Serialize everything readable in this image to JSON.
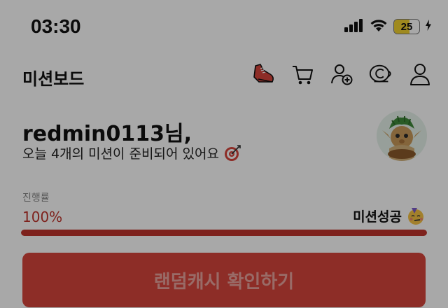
{
  "status_bar": {
    "time": "03:30",
    "battery_level": "25",
    "icons": [
      "cellular-signal-icon",
      "wifi-icon",
      "battery-charging-icon"
    ]
  },
  "header": {
    "title": "미션보드",
    "icons": [
      "sneaker-icon",
      "cart-icon",
      "add-friend-icon",
      "coin-icon",
      "profile-icon"
    ]
  },
  "greeting": {
    "name": "redmin0113님,",
    "subtitle": "오늘 4개의 미션이 준비되어 있어요",
    "subtitle_icon": "target-icon",
    "avatar_icon": "goblin-avatar"
  },
  "progress": {
    "label": "진행률",
    "percent_text": "100%",
    "value": 1.0,
    "status_text": "미션성공",
    "status_icon": "party-face-icon"
  },
  "cta": {
    "label": "랜덤캐시 확인하기"
  },
  "colors": {
    "accent": "#c0352d",
    "button": "#d6453c",
    "button_text": "#e8a39d",
    "overlay": "rgba(0,0,0,0.34)"
  }
}
